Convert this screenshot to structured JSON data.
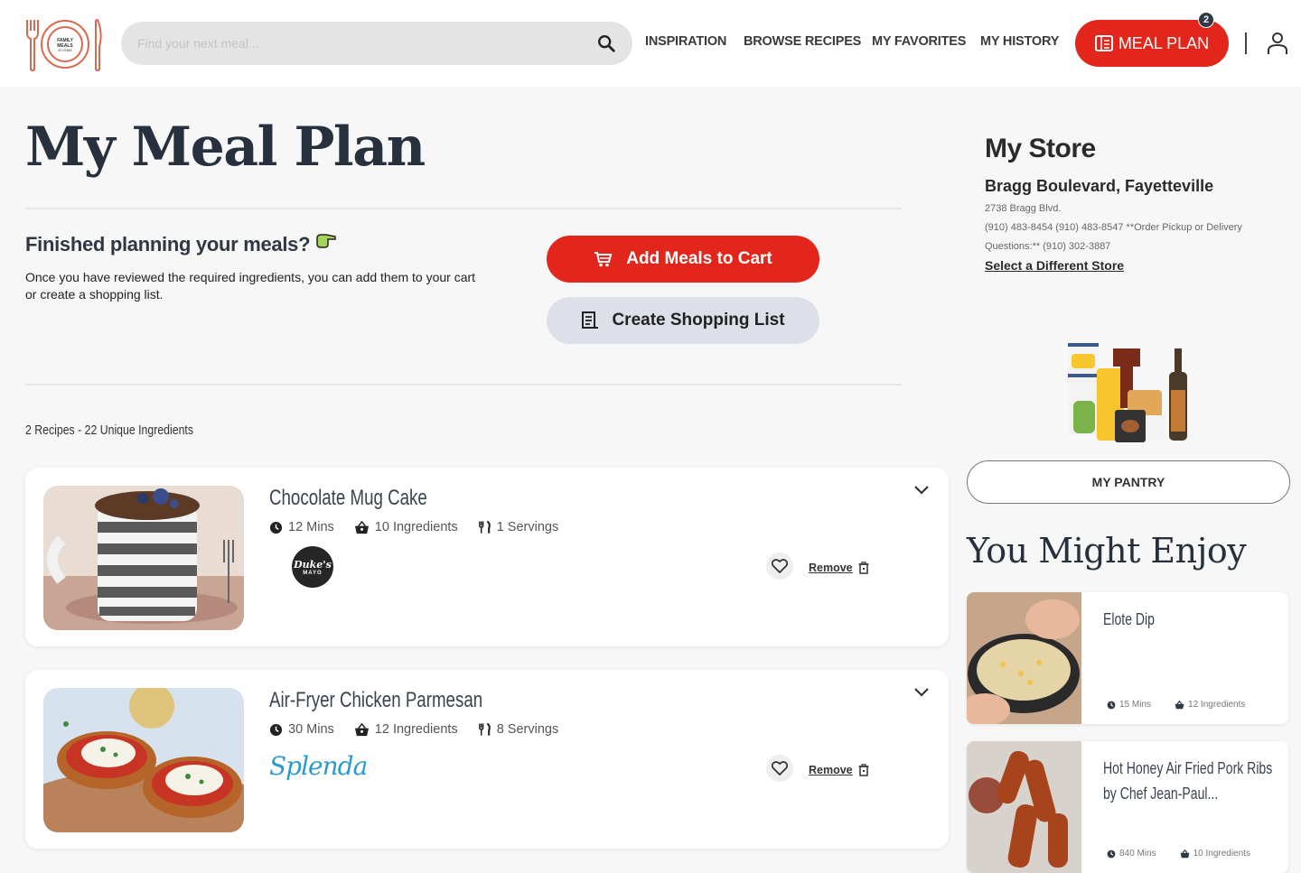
{
  "header": {
    "logo_alt": "Family Meals at Home",
    "search_placeholder": "Find your next meal...",
    "nav": [
      "INSPIRATION",
      "BROWSE RECIPES",
      "MY FAVORITES",
      "MY HISTORY"
    ],
    "meal_plan_label": "MEAL PLAN",
    "meal_plan_count": "2",
    "accent": "#e3261b"
  },
  "page": {
    "title": "My Meal Plan",
    "finished_heading": "Finished planning your meals?",
    "finished_desc": "Once you have reviewed the required ingredients, you can add them to your cart or create a shopping list.",
    "add_cart_label": "Add Meals to Cart",
    "shopping_list_label": "Create Shopping List",
    "count_text": "2 Recipes - 22  Unique Ingredients"
  },
  "recipes": [
    {
      "title": "Chocolate Mug Cake",
      "time": "12 Mins",
      "ingredients": "10 Ingredients",
      "servings": "1 Servings",
      "sponsor": "Duke's",
      "sponsor_sub": "MAYO",
      "remove_label": "Remove"
    },
    {
      "title": "Air-Fryer Chicken Parmesan",
      "time": "30 Mins",
      "ingredients": "12 Ingredients",
      "servings": "8 Servings",
      "sponsor": "Splenda",
      "remove_label": "Remove"
    }
  ],
  "store": {
    "heading": "My Store",
    "name": "Bragg Boulevard, Fayetteville",
    "address": "2738 Bragg Blvd.",
    "phones": "(910) 483-8454 (910) 483-8547 **Order Pickup or Delivery Questions:** (910) 302-3887",
    "change_link": "Select a Different Store"
  },
  "pantry": {
    "button_label": "MY PANTRY"
  },
  "suggestions": {
    "heading": "You Might Enjoy",
    "items": [
      {
        "title": "Elote Dip",
        "time": "15 Mins",
        "ingredients": "12 Ingredients"
      },
      {
        "title": "Hot Honey Air Fried Pork Ribs by Chef Jean-Paul...",
        "time": "840 Mins",
        "ingredients": "10 Ingredients"
      }
    ]
  }
}
